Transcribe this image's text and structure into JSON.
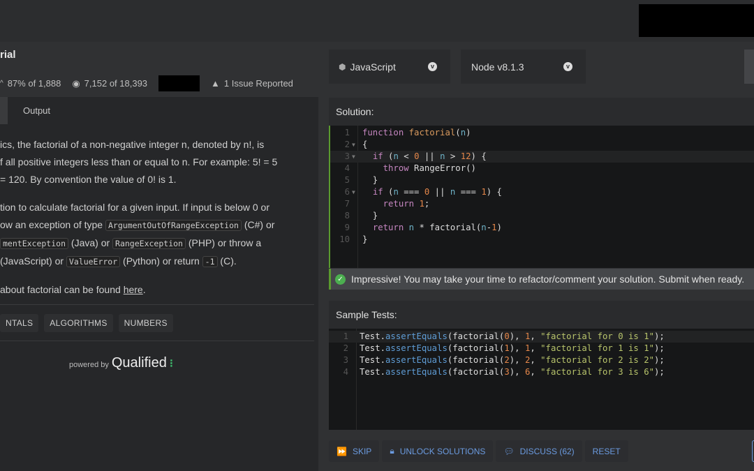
{
  "kata": {
    "title": "rial",
    "rank_pct": "87% of 1,888",
    "completed": "7,152 of 18,393",
    "issues": "1 Issue Reported"
  },
  "tabs": {
    "output": "Output"
  },
  "description": {
    "p1": [
      "ics, the factorial of a non-negative integer n, denoted by n!, is",
      "f all positive integers less than or equal to n. For example: 5! = 5",
      "= 120. By convention the value of 0! is 1."
    ],
    "p2a": "tion to calculate factorial for a given input. If input is below 0 or",
    "p2b_pre": "ow an exception of type ",
    "code_cs": "ArgumentOutOfRangeException",
    "p2b_post": " (C#) or",
    "code_java": "mentException",
    "p2c_mid": " (Java) or ",
    "code_php": "RangeException",
    "p2c_post": " (PHP) or throw a",
    "p2d_pre": "(JavaScript) or ",
    "code_py": "ValueError",
    "p2d_mid": " (Python) or return ",
    "code_c": "-1",
    "p2d_post": " (C).",
    "p3_pre": "about factorial can be found ",
    "p3_link": "here",
    "p3_post": "."
  },
  "tags": [
    "NTALS",
    "ALGORITHMS",
    "NUMBERS"
  ],
  "powered": {
    "by": "powered by",
    "brand": "Qualified"
  },
  "language": {
    "selected": "JavaScript",
    "version": "Node v8.1.3"
  },
  "solution": {
    "label": "Solution:"
  },
  "success": "Impressive! You may take your time to refactor/comment your solution. Submit when ready.",
  "sample_tests": {
    "label": "Sample Tests:"
  },
  "buttons": {
    "skip": "SKIP",
    "unlock": "UNLOCK SOLUTIONS",
    "discuss": "DISCUSS (62)",
    "reset": "RESET"
  },
  "colors": {
    "success": "#4caf50",
    "button_text": "#6b9be0",
    "code_bg": "#161718"
  }
}
